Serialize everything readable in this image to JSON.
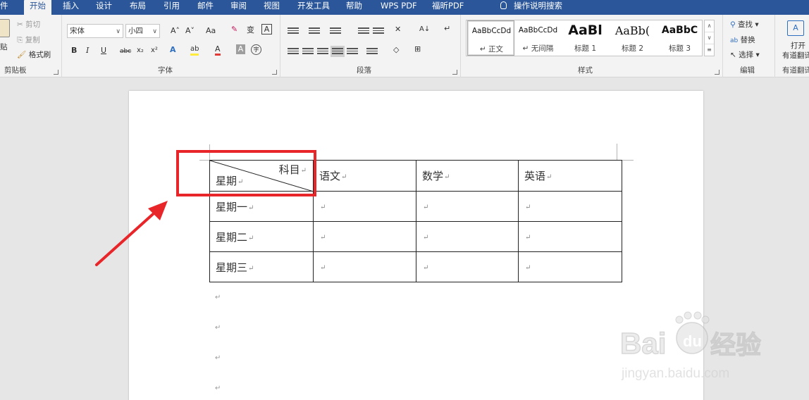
{
  "ribbon_tabs": {
    "file": "件",
    "home": "开始",
    "insert": "插入",
    "design": "设计",
    "layout": "布局",
    "references": "引用",
    "mailings": "邮件",
    "review": "审阅",
    "view": "视图",
    "developer": "开发工具",
    "help": "帮助",
    "wps_pdf": "WPS PDF",
    "foxit_pdf": "福昕PDF",
    "tell_me": "操作说明搜索"
  },
  "clipboard": {
    "paste": "贴",
    "cut": "剪切",
    "copy": "复制",
    "format_painter": "格式刷",
    "label": "剪贴板"
  },
  "font": {
    "name": "宋体",
    "size": "小四",
    "grow": "A˄",
    "shrink": "A˅",
    "case": "Aa",
    "phonetic": "变",
    "border_char": "A",
    "bold": "B",
    "italic": "I",
    "underline": "U",
    "strike": "abc",
    "subscript": "x₂",
    "superscript": "x²",
    "effects": "A",
    "highlight": "ab",
    "color": "A",
    "shading": "A",
    "enclose": "字",
    "label": "字体"
  },
  "paragraph": {
    "label": "段落",
    "sort": "A↓",
    "marks": "↵"
  },
  "styles": {
    "label": "样式",
    "items": [
      {
        "sample": "AaBbCcDd",
        "name": "↵ 正文"
      },
      {
        "sample": "AaBbCcDd",
        "name": "↵ 无间隔"
      },
      {
        "sample": "AaBl",
        "name": "标题 1"
      },
      {
        "sample": "AaBb(",
        "name": "标题 2"
      },
      {
        "sample": "AaBbC",
        "name": "标题 3"
      }
    ]
  },
  "editing": {
    "find": "查找",
    "replace": "替换",
    "select": "选择",
    "label": "编辑"
  },
  "youdao": {
    "open": "打开",
    "line2": "有道翻译",
    "label": "有道翻译"
  },
  "table": {
    "header_top_right": "科目",
    "header_bottom_left": "星期",
    "columns": [
      "语文",
      "数学",
      "英语"
    ],
    "rows": [
      "星期一",
      "星期二",
      "星期三"
    ],
    "return_mark": "↵"
  },
  "colors": {
    "ribbon_blue": "#2b579a",
    "highlight_red": "#e8262a"
  }
}
